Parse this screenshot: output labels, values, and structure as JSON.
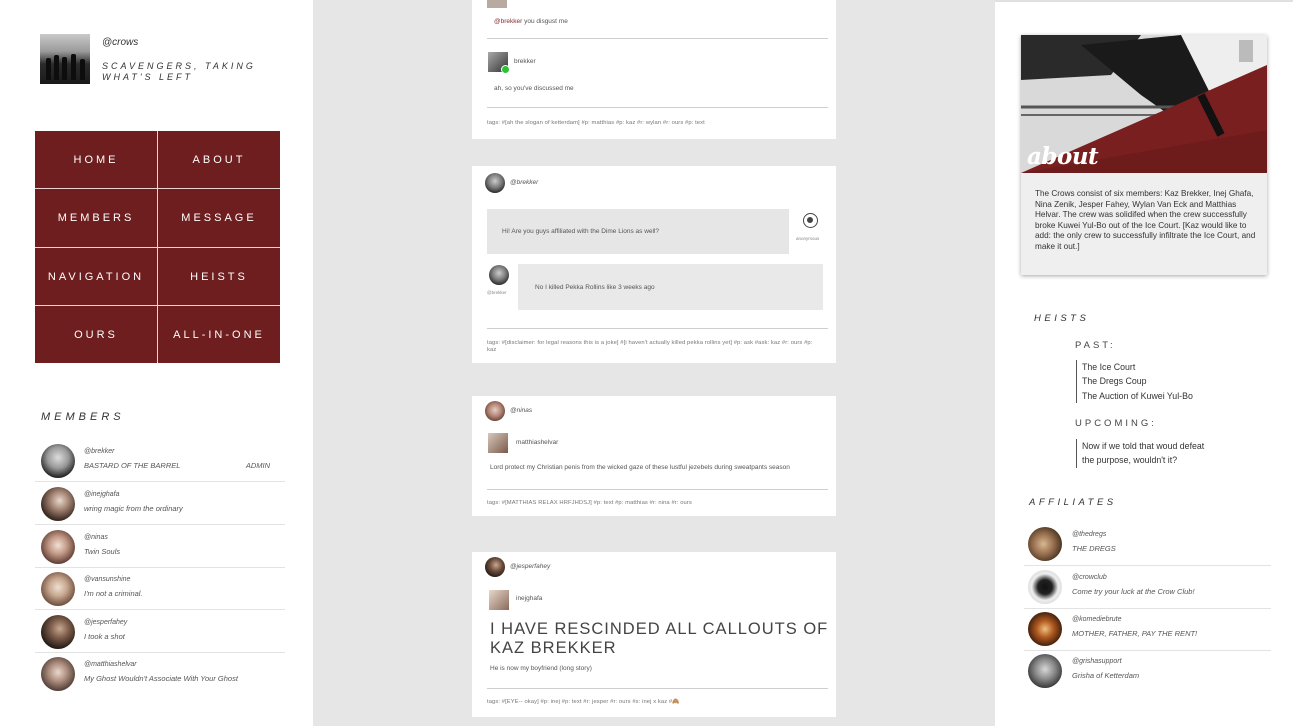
{
  "blog": {
    "handle": "@crows",
    "tagline": "SCAVENGERS, TAKING WHAT'S LEFT"
  },
  "nav": {
    "items": [
      "HOME",
      "ABOUT",
      "MEMBERS",
      "MESSAGE",
      "NAVIGATION",
      "HEISTS",
      "OURS",
      "ALL-IN-ONE"
    ]
  },
  "members": {
    "title": "MEMBERS",
    "items": [
      {
        "handle": "@brekker",
        "desc": "BASTARD OF THE BARREL",
        "role": "ADMIN"
      },
      {
        "handle": "@inejghafa",
        "desc": "wring magic from the ordinary",
        "role": ""
      },
      {
        "handle": "@ninas",
        "desc": "Twin Souls",
        "role": ""
      },
      {
        "handle": "@vansunshine",
        "desc": "I'm not a criminal.",
        "role": ""
      },
      {
        "handle": "@jesperfahey",
        "desc": "I took a shot",
        "role": ""
      },
      {
        "handle": "@matthiashelvar",
        "desc": "My Ghost Wouldn't Associate With Your Ghost",
        "role": ""
      }
    ]
  },
  "posts": {
    "p1": {
      "top_user": "@brekker",
      "top_text": "you disgust me",
      "reply_user": "brekker",
      "reply_text": "ah, so you've discussed me",
      "tags": "tags:  #[ah the slogan of ketterdam]  #p: matthias  #p: kaz  #r: wylan  #r: ours  #p: text"
    },
    "p2": {
      "user": "@brekker",
      "question": "Hi! Are you guys affiliated with the Dime Lions as well?",
      "asker": "anonymous",
      "answer": "No I killed Pekka Rollins like 3 weeks ago",
      "answerer": "@brekker",
      "tags": "tags:  #[disclaimer: for legal reasons this is a joke]  #[i haven't actually killed pekka rollins yet]  #p: ask  #ask: kaz  #r: ours  #p: kaz"
    },
    "p3": {
      "user": "@ninas",
      "reblog_user": "matthiashelvar",
      "text": "Lord protect my Christian penis from the wicked gaze of these lustful jezebels during sweatpants season",
      "tags": "tags:  #[MATTHIAS RELAX HRFJHDSJ]  #p: text  #p: matthias  #r: nina  #r: ours"
    },
    "p4": {
      "user": "@jesperfahey",
      "reblog_user": "inejghafa",
      "headline": "I HAVE RESCINDED ALL CALLOUTS OF KAZ BREKKER",
      "sub": "He is now my boyfriend (long story)",
      "tags": "tags:  #[EYE-- okay]  #p: inej  #p: text  #r: jesper  #r: ours  #s: inej x kaz  #🙈"
    }
  },
  "about": {
    "title": "about",
    "text": "The Crows consist of six members: Kaz Brekker, Inej Ghafa, Nina Zenik, Jesper Fahey, Wylan Van Eck and Matthias Helvar. The crew was solidifed when the crew successfully broke Kuwei Yul-Bo out of the Ice Court. [Kaz would like to add: the only crew to successfully infiltrate the Ice Court, and make it out.]"
  },
  "heists": {
    "title": "HEISTS",
    "past_label": "PAST:",
    "past": [
      "The Ice Court",
      "The Dregs Coup",
      "The Auction of Kuwei Yul-Bo"
    ],
    "upcoming_label": "UPCOMING:",
    "upcoming": [
      "Now if we told that woud defeat",
      "the purpose, wouldn't it?"
    ]
  },
  "affiliates": {
    "title": "AFFILIATES",
    "items": [
      {
        "handle": "@thedregs",
        "desc": "THE DREGS"
      },
      {
        "handle": "@crowclub",
        "desc": "Come try your luck at the Crow Club!"
      },
      {
        "handle": "@komediebrute",
        "desc": "MOTHER, FATHER, PAY THE RENT!"
      },
      {
        "handle": "@grishasupport",
        "desc": "Grisha of Ketterdam"
      }
    ]
  },
  "colors": {
    "accent": "#6e1e1e",
    "link": "#8b2b2b",
    "panel_bg": "#ffffff",
    "page_bg": "#e6e6e6"
  }
}
